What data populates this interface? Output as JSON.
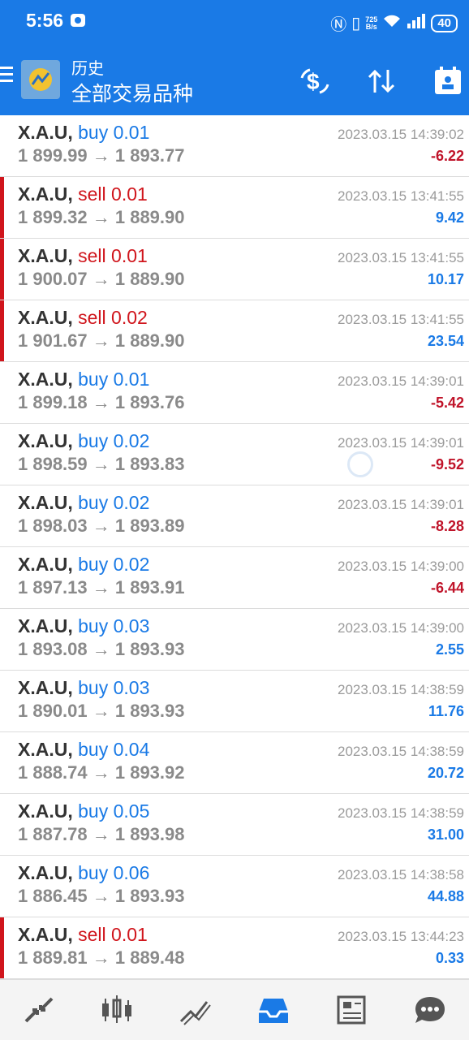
{
  "status_bar": {
    "time": "5:56",
    "net_speed_top": "725",
    "net_speed_bottom": "B/s",
    "battery": "40"
  },
  "header": {
    "subtitle": "历史",
    "title": "全部交易品种"
  },
  "colors": {
    "app_bar": "#1a7ae6",
    "buy": "#1a7ae6",
    "sell": "#d0151c",
    "negative": "#c0142a",
    "positive": "#1a7ae6"
  },
  "icons": {
    "menu": "menu-icon",
    "app_logo": "app-logo-icon",
    "deposit": "dollar-exchange-icon",
    "sort": "sort-icon",
    "calendar": "calendar-icon"
  },
  "trades": [
    {
      "symbol": "X.A.U,",
      "direction": "buy",
      "lot": "buy 0.01",
      "prices": "1 899.99 → 1 893.77",
      "time": "2023.03.15 14:39:02",
      "profit": "-6.22"
    },
    {
      "symbol": "X.A.U,",
      "direction": "sell",
      "lot": "sell 0.01",
      "prices": "1 899.32 → 1 889.90",
      "time": "2023.03.15 13:41:55",
      "profit": "9.42"
    },
    {
      "symbol": "X.A.U,",
      "direction": "sell",
      "lot": "sell 0.01",
      "prices": "1 900.07 → 1 889.90",
      "time": "2023.03.15 13:41:55",
      "profit": "10.17"
    },
    {
      "symbol": "X.A.U,",
      "direction": "sell",
      "lot": "sell 0.02",
      "prices": "1 901.67 → 1 889.90",
      "time": "2023.03.15 13:41:55",
      "profit": "23.54"
    },
    {
      "symbol": "X.A.U,",
      "direction": "buy",
      "lot": "buy 0.01",
      "prices": "1 899.18 → 1 893.76",
      "time": "2023.03.15 14:39:01",
      "profit": "-5.42"
    },
    {
      "symbol": "X.A.U,",
      "direction": "buy",
      "lot": "buy 0.02",
      "prices": "1 898.59 → 1 893.83",
      "time": "2023.03.15 14:39:01",
      "profit": "-9.52"
    },
    {
      "symbol": "X.A.U,",
      "direction": "buy",
      "lot": "buy 0.02",
      "prices": "1 898.03 → 1 893.89",
      "time": "2023.03.15 14:39:01",
      "profit": "-8.28"
    },
    {
      "symbol": "X.A.U,",
      "direction": "buy",
      "lot": "buy 0.02",
      "prices": "1 897.13 → 1 893.91",
      "time": "2023.03.15 14:39:00",
      "profit": "-6.44"
    },
    {
      "symbol": "X.A.U,",
      "direction": "buy",
      "lot": "buy 0.03",
      "prices": "1 893.08 → 1 893.93",
      "time": "2023.03.15 14:39:00",
      "profit": "2.55"
    },
    {
      "symbol": "X.A.U,",
      "direction": "buy",
      "lot": "buy 0.03",
      "prices": "1 890.01 → 1 893.93",
      "time": "2023.03.15 14:38:59",
      "profit": "11.76"
    },
    {
      "symbol": "X.A.U,",
      "direction": "buy",
      "lot": "buy 0.04",
      "prices": "1 888.74 → 1 893.92",
      "time": "2023.03.15 14:38:59",
      "profit": "20.72"
    },
    {
      "symbol": "X.A.U,",
      "direction": "buy",
      "lot": "buy 0.05",
      "prices": "1 887.78 → 1 893.98",
      "time": "2023.03.15 14:38:59",
      "profit": "31.00"
    },
    {
      "symbol": "X.A.U,",
      "direction": "buy",
      "lot": "buy 0.06",
      "prices": "1 886.45 → 1 893.93",
      "time": "2023.03.15 14:38:58",
      "profit": "44.88"
    },
    {
      "symbol": "X.A.U,",
      "direction": "sell",
      "lot": "sell 0.01",
      "prices": "1 889.81 → 1 889.48",
      "time": "2023.03.15 13:44:23",
      "profit": "0.33"
    }
  ],
  "bottom_nav": [
    {
      "name": "quotes-icon"
    },
    {
      "name": "chart-icon"
    },
    {
      "name": "trade-icon"
    },
    {
      "name": "history-icon",
      "active": true
    },
    {
      "name": "news-icon"
    },
    {
      "name": "chat-icon"
    }
  ]
}
